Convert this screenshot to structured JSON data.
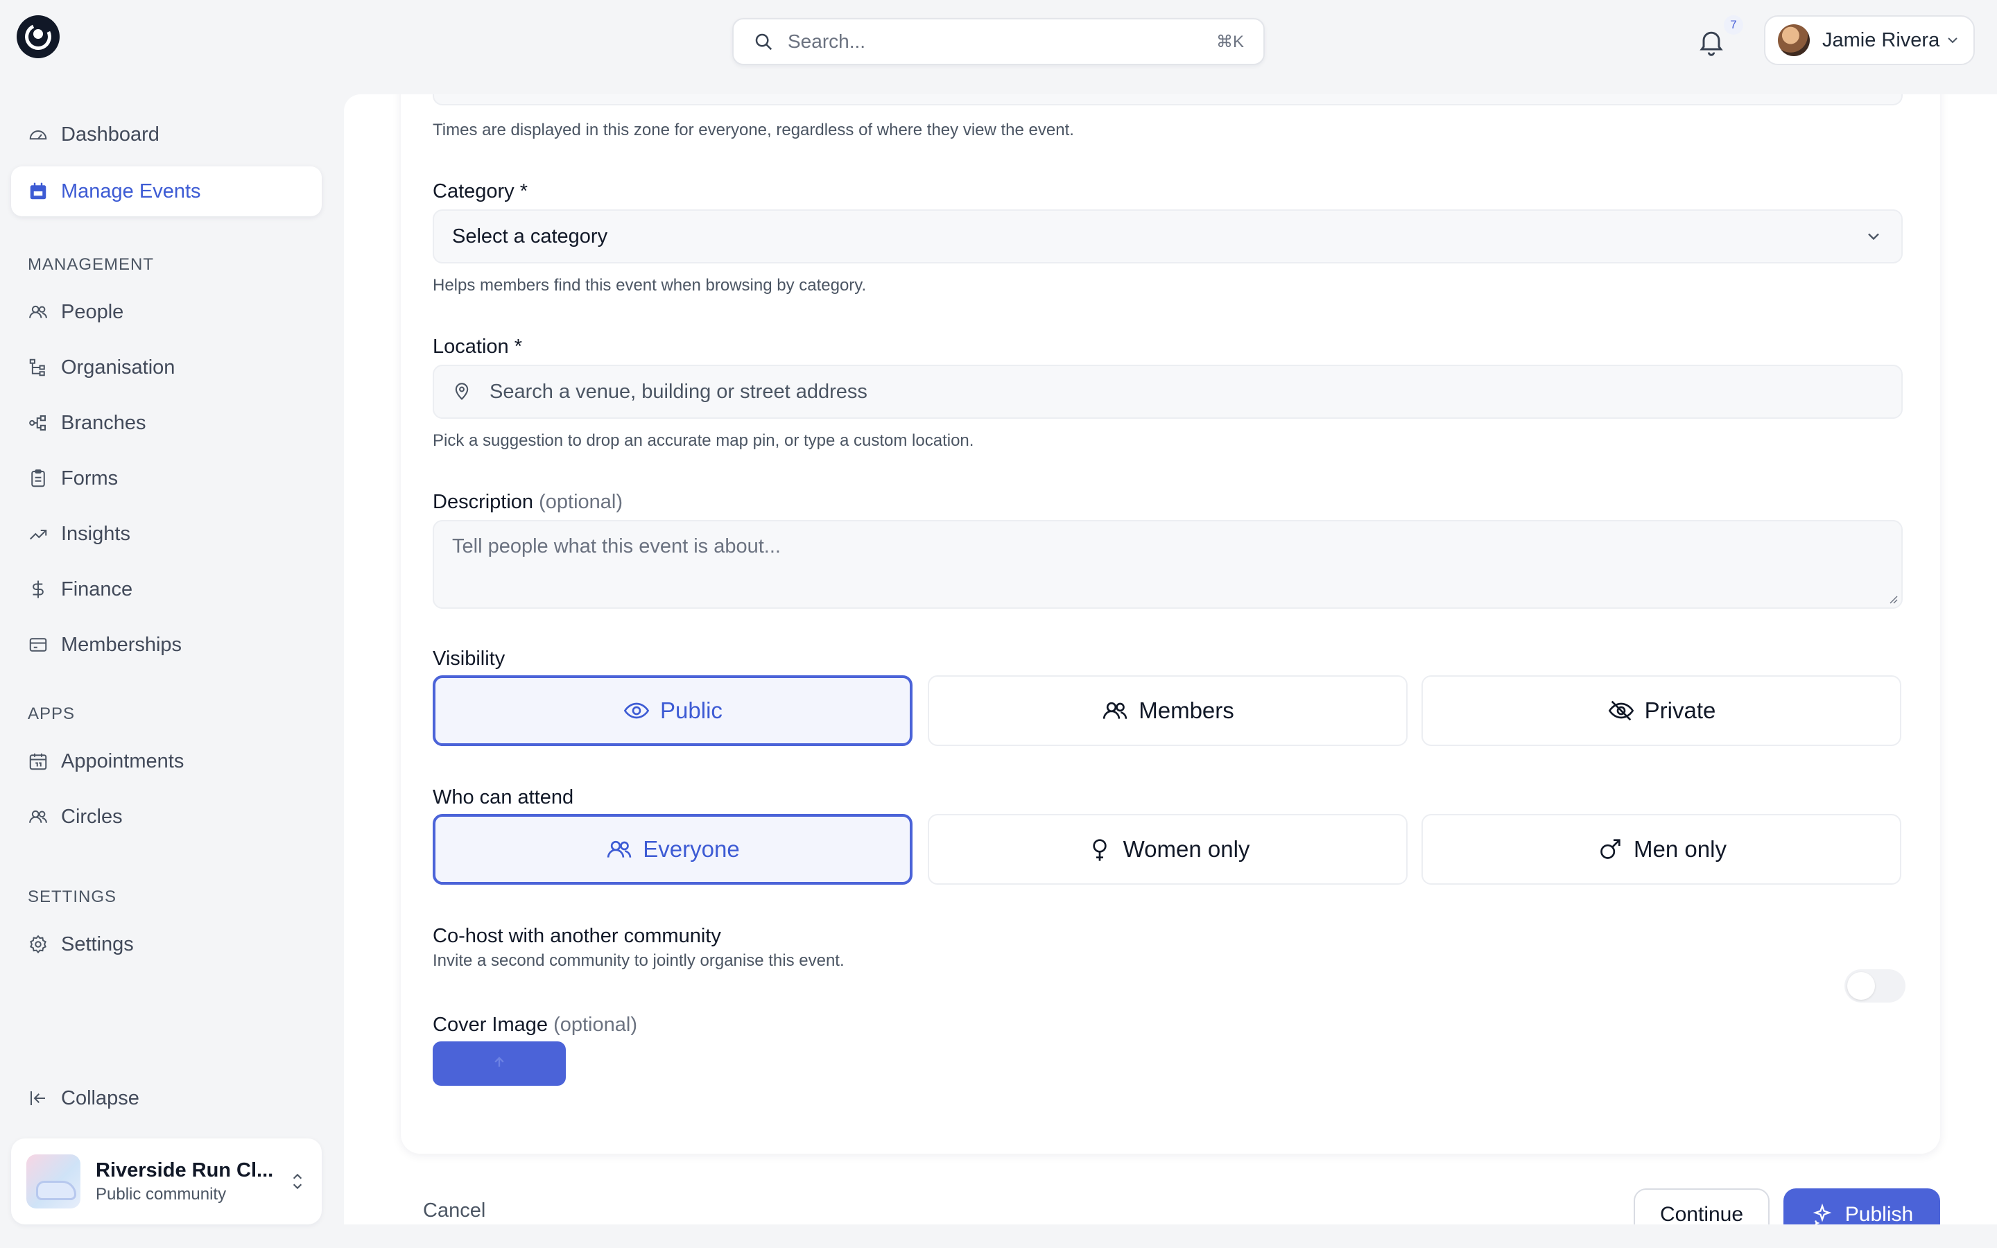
{
  "topbar": {
    "search_placeholder": "Search...",
    "search_shortcut": "⌘K",
    "notification_count": "7",
    "user_name": "Jamie Rivera"
  },
  "sidebar": {
    "primary": [
      {
        "label": "Dashboard",
        "icon": "gauge-icon"
      },
      {
        "label": "Manage Events",
        "icon": "calendar-icon",
        "active": true
      }
    ],
    "management_label": "MANAGEMENT",
    "management": [
      {
        "label": "People",
        "icon": "users-icon"
      },
      {
        "label": "Organisation",
        "icon": "hierarchy-icon"
      },
      {
        "label": "Branches",
        "icon": "branches-icon"
      },
      {
        "label": "Forms",
        "icon": "clipboard-icon"
      },
      {
        "label": "Insights",
        "icon": "trend-icon"
      },
      {
        "label": "Finance",
        "icon": "dollar-icon"
      },
      {
        "label": "Memberships",
        "icon": "card-icon"
      }
    ],
    "apps_label": "APPS",
    "apps": [
      {
        "label": "Appointments",
        "icon": "calendar-icon"
      },
      {
        "label": "Circles",
        "icon": "users-icon"
      }
    ],
    "settings_label": "SETTINGS",
    "settings": [
      {
        "label": "Settings",
        "icon": "gear-icon"
      }
    ],
    "collapse_label": "Collapse",
    "community": {
      "name": "Riverside Run Cl...",
      "subtitle": "Public community"
    }
  },
  "form": {
    "timezone_help": "Times are displayed in this zone for everyone, regardless of where they view the event.",
    "category": {
      "label": "Category *",
      "value": "Select a category",
      "help": "Helps members find this event when browsing by category."
    },
    "location": {
      "label": "Location *",
      "placeholder": "Search a venue, building or street address",
      "help": "Pick a suggestion to drop an accurate map pin, or type a custom location."
    },
    "description": {
      "label": "Description",
      "optional": "(optional)",
      "placeholder": "Tell people what this event is about..."
    },
    "visibility": {
      "label": "Visibility",
      "options": [
        {
          "label": "Public",
          "icon": "eye-icon",
          "selected": true
        },
        {
          "label": "Members",
          "icon": "users-icon",
          "selected": false
        },
        {
          "label": "Private",
          "icon": "eye-off-icon",
          "selected": false
        }
      ]
    },
    "attendance": {
      "label": "Who can attend",
      "options": [
        {
          "label": "Everyone",
          "icon": "users-icon",
          "selected": true
        },
        {
          "label": "Women only",
          "icon": "female-icon",
          "selected": false
        },
        {
          "label": "Men only",
          "icon": "male-icon",
          "selected": false
        }
      ]
    },
    "cohost": {
      "label": "Co-host with another community",
      "help": "Invite a second community to jointly organise this event.",
      "enabled": false
    },
    "cover_image": {
      "label": "Cover Image",
      "optional": "(optional)"
    }
  },
  "footer": {
    "cancel": "Cancel",
    "continue": "Continue",
    "publish": "Publish"
  },
  "colors": {
    "accent": "#4b63d8",
    "background": "#f4f5f7"
  }
}
